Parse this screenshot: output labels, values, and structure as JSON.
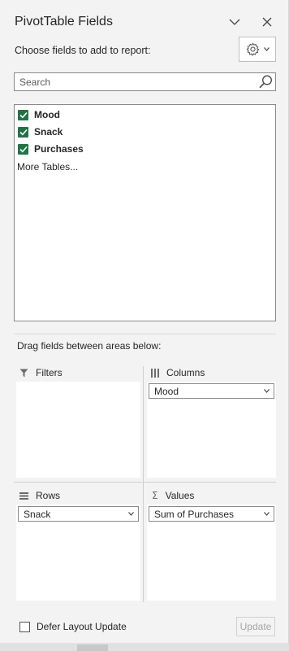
{
  "pane": {
    "title": "PivotTable Fields",
    "choose_label": "Choose fields to add to report:"
  },
  "search": {
    "placeholder": "Search"
  },
  "fields": [
    {
      "label": "Mood",
      "checked": true
    },
    {
      "label": "Snack",
      "checked": true
    },
    {
      "label": "Purchases",
      "checked": true
    }
  ],
  "more_tables": "More Tables...",
  "drag_label": "Drag fields between areas below:",
  "areas": {
    "filters": {
      "title": "Filters",
      "items": []
    },
    "columns": {
      "title": "Columns",
      "items": [
        "Mood"
      ]
    },
    "rows": {
      "title": "Rows",
      "items": [
        "Snack"
      ]
    },
    "values": {
      "title": "Values",
      "items": [
        "Sum of Purchases"
      ]
    }
  },
  "defer": {
    "label": "Defer Layout Update",
    "checked": false
  },
  "update_label": "Update",
  "colors": {
    "accent": "#217346",
    "pane_bg": "#f3f3f3"
  }
}
